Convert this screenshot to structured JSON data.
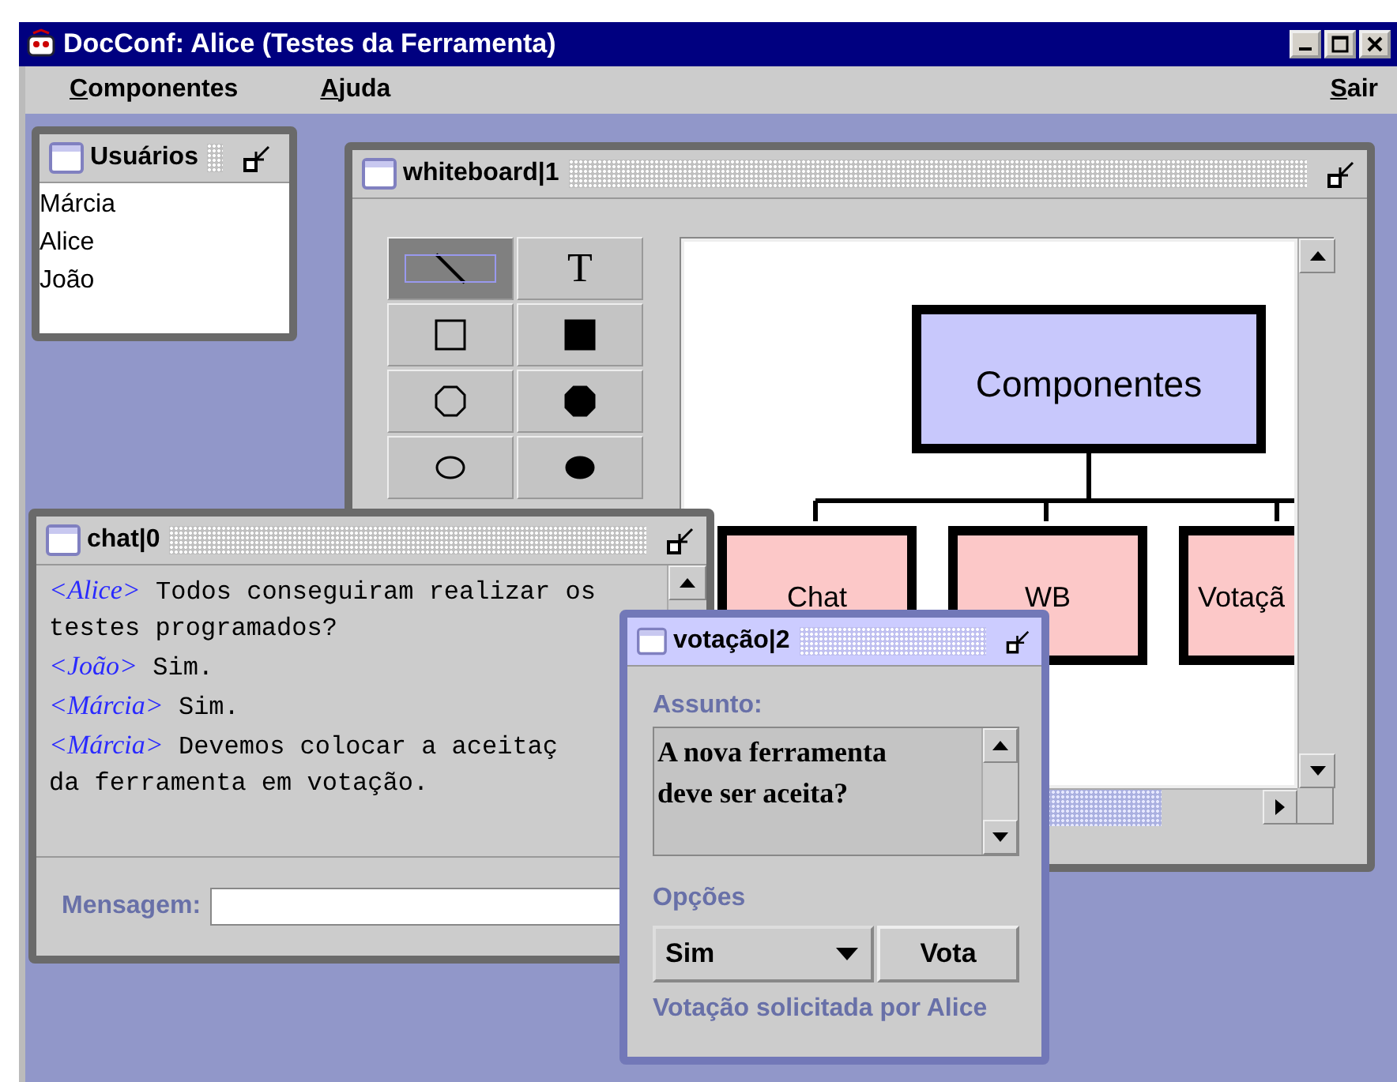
{
  "window": {
    "title": "DocConf: Alice (Testes da Ferramenta)"
  },
  "menu": [
    {
      "label": "Componentes"
    },
    {
      "label": "Ajuda"
    },
    {
      "label": "Sair"
    }
  ],
  "users_frame": {
    "title": "Usuários",
    "active": false,
    "items": [
      "Márcia",
      "Alice",
      "João"
    ]
  },
  "whiteboard_frame": {
    "title": "whiteboard|1",
    "active": false,
    "tools": [
      {
        "kind": "line",
        "selected": true
      },
      {
        "kind": "text",
        "label": "T",
        "selected": false
      },
      {
        "kind": "square",
        "selected": false
      },
      {
        "kind": "filled-square",
        "selected": false
      },
      {
        "kind": "octagon",
        "selected": false
      },
      {
        "kind": "filled-octagon",
        "selected": false
      },
      {
        "kind": "oval",
        "selected": false
      },
      {
        "kind": "filled-oval",
        "selected": false
      }
    ],
    "diagram": {
      "root": "Componentes",
      "children": [
        "Chat",
        "WB",
        "Votaçã"
      ]
    }
  },
  "chat_frame": {
    "title": "chat|0",
    "active": false,
    "messages": [
      {
        "user": "<Alice>",
        "lines": [
          "Todos conseguiram realizar os",
          "testes programados?"
        ]
      },
      {
        "user": "<João>",
        "lines": [
          "Sim."
        ]
      },
      {
        "user": "<Márcia>",
        "lines": [
          "Sim."
        ]
      },
      {
        "user": "<Márcia>",
        "lines": [
          "Devemos colocar a aceitaç",
          "da ferramenta em votação."
        ]
      }
    ],
    "input_label": "Mensagem:"
  },
  "vote_frame": {
    "title": "votação|2",
    "active": true,
    "subject_label": "Assunto:",
    "subject_lines": [
      "A nova ferramenta",
      "deve ser aceita?"
    ],
    "options_label": "Opções",
    "choice": "Sim",
    "button": "Vota",
    "footer": "Votação solicitada por Alice"
  }
}
